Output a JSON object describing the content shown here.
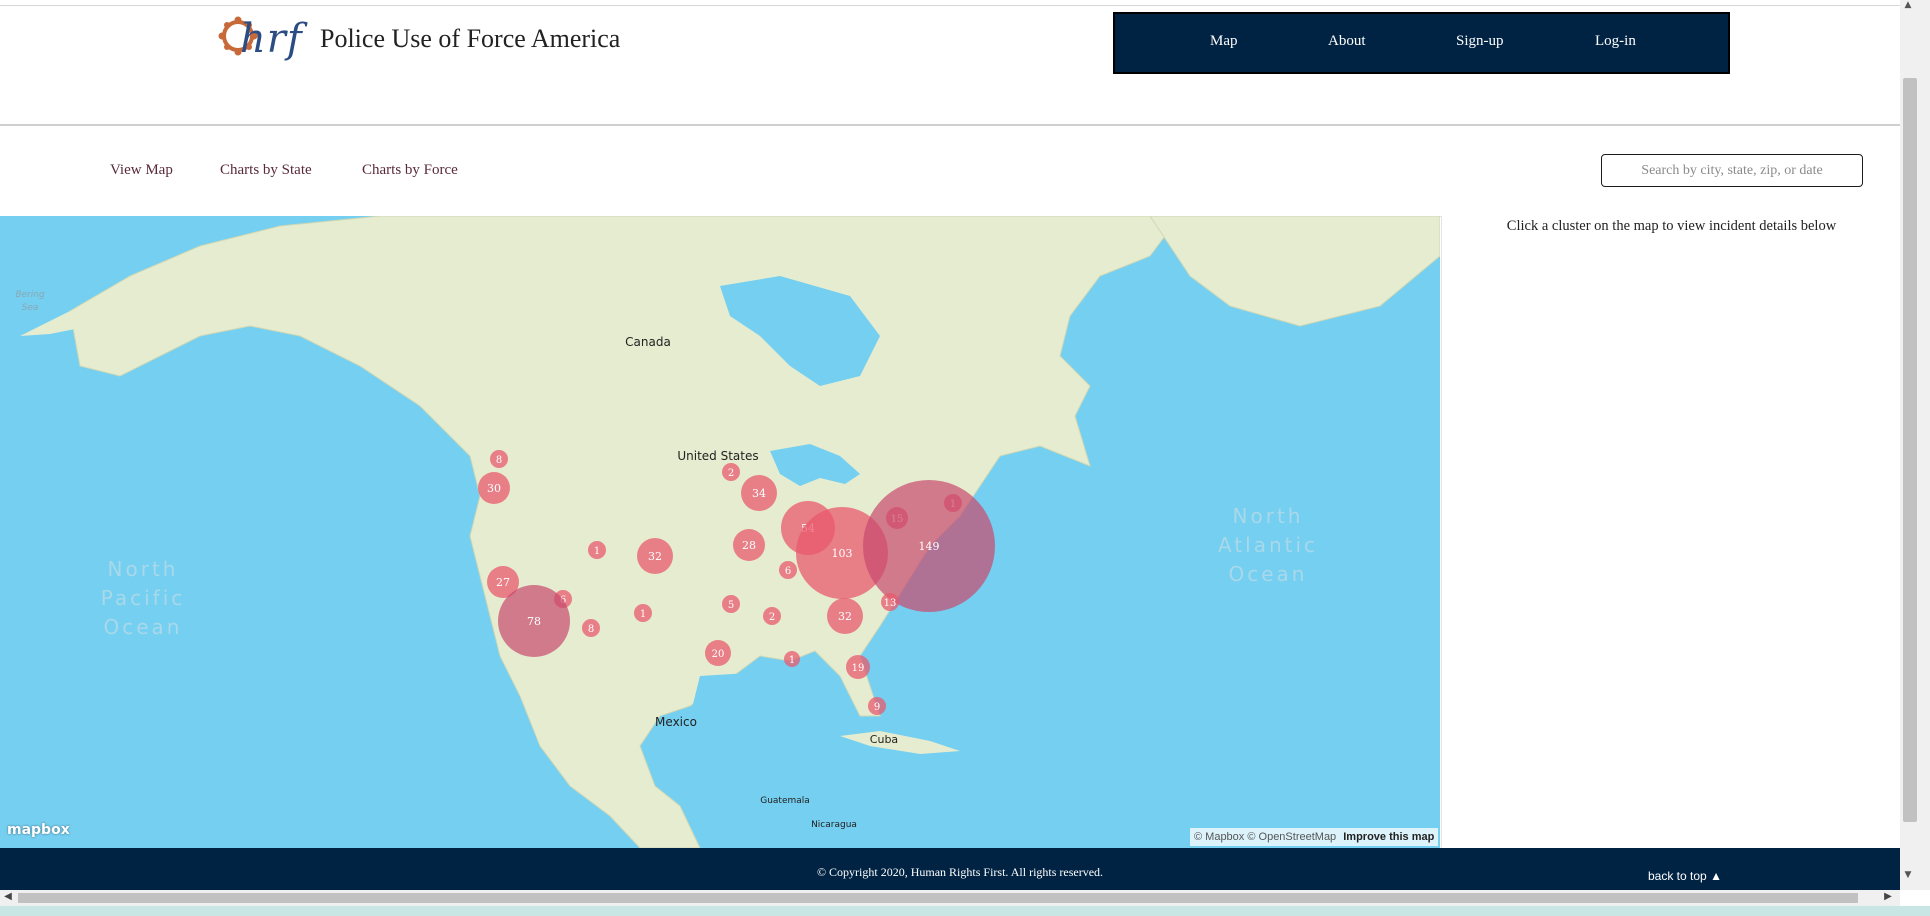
{
  "header": {
    "logo_text": "hrf",
    "site_title": "Police Use of Force America"
  },
  "nav": {
    "items": [
      "Map",
      "About",
      "Sign-up",
      "Log-in"
    ]
  },
  "subnav": {
    "links": [
      "View Map",
      "Charts by State",
      "Charts by Force"
    ],
    "search_placeholder": "Search by city, state, zip, or date"
  },
  "map": {
    "labels": {
      "canada": "Canada",
      "united_states": "United States",
      "mexico": "Mexico",
      "cuba": "Cuba",
      "guatemala": "Guatemala",
      "nicaragua": "Nicaragua",
      "bering_sea_1": "Bering",
      "bering_sea_2": "Sea",
      "north_pacific_1": "North",
      "north_pacific_2": "Pacific",
      "north_pacific_3": "Ocean",
      "north_atlantic_1": "North",
      "north_atlantic_2": "Atlantic",
      "north_atlantic_3": "Ocean"
    },
    "clusters": [
      "8",
      "30",
      "2",
      "34",
      "54",
      "28",
      "1",
      "32",
      "6",
      "103",
      "15",
      "1",
      "149",
      "27",
      "6",
      "78",
      "1",
      "5",
      "2",
      "32",
      "13",
      "8",
      "20",
      "1",
      "19",
      "9"
    ],
    "mapbox_logo": "mapbox",
    "attribution": {
      "mapbox": "© Mapbox",
      "osm": "© OpenStreetMap",
      "improve": "Improve this map"
    },
    "colors": {
      "water": "#75cff0",
      "land": "#e6eccf",
      "cluster": "#e85a6e"
    }
  },
  "side_panel": {
    "hint": "Click a cluster on the map to view incident details below"
  },
  "footer": {
    "copyright": "© Copyright 2020, Human Rights First. All rights reserved.",
    "back_to_top": "back to top"
  }
}
